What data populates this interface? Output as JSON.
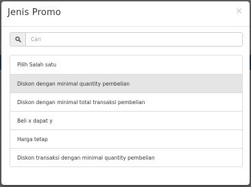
{
  "modal": {
    "title": "Jenis Promo",
    "close_label": "×"
  },
  "search": {
    "icon": "search-icon",
    "placeholder": "Cari"
  },
  "options": [
    {
      "label": "Pilih Salah satu",
      "active": false
    },
    {
      "label": "Diskon dengan minimal quantity pembelian",
      "active": true
    },
    {
      "label": "Diskon dengan minimal total transaksi pembelian",
      "active": false
    },
    {
      "label": "Beli x dapat y",
      "active": false
    },
    {
      "label": "Harga tetap",
      "active": false
    },
    {
      "label": "Diskon transaksi dengan minimal quantity pembelian",
      "active": false
    }
  ],
  "colors": {
    "highlight": "#e5e5e5",
    "backdrop": "#616161",
    "background_nav": "#1b3550"
  }
}
